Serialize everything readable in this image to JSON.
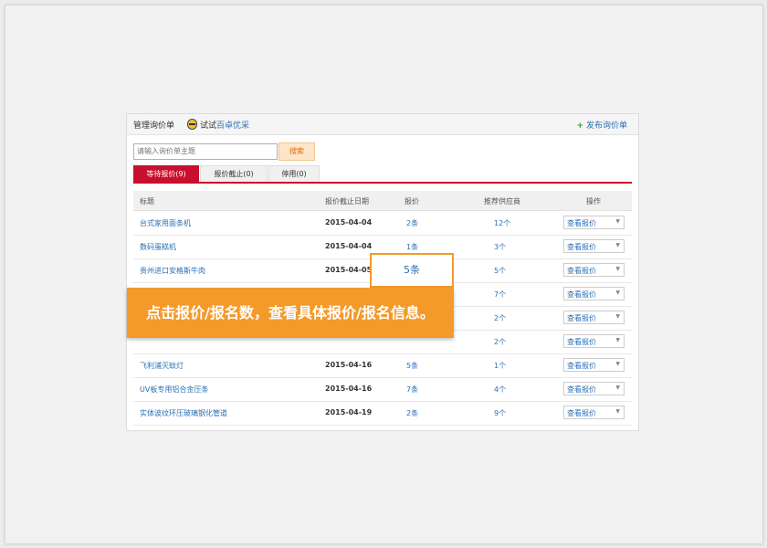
{
  "header": {
    "title": "管理询价单",
    "trial_prefix": "试试",
    "trial_brand": "百卓优采",
    "publish_label": "发布询价单"
  },
  "search": {
    "placeholder": "请输入询价单主题",
    "button_label": "搜索"
  },
  "tabs": [
    {
      "label": "等待报价(9)",
      "active": true
    },
    {
      "label": "报价截止(0)",
      "active": false
    },
    {
      "label": "停用(0)",
      "active": false
    }
  ],
  "table": {
    "headers": [
      "标题",
      "报价截止日期",
      "报价",
      "推荐供应商",
      "操作"
    ],
    "rows": [
      {
        "title": "台式家用面条机",
        "date": "2015-04-04",
        "quotes": "2条",
        "suppliers": "12个",
        "action": "查看报价"
      },
      {
        "title": "数码蛋糕机",
        "date": "2015-04-04",
        "quotes": "1条",
        "suppliers": "3个",
        "action": "查看报价"
      },
      {
        "title": "贵州进口安格斯牛肉",
        "date": "2015-04-05",
        "quotes": "",
        "suppliers": "5个",
        "action": "查看报价"
      },
      {
        "title": "",
        "date": "",
        "quotes": "",
        "suppliers": "7个",
        "action": "查看报价"
      },
      {
        "title": "",
        "date": "",
        "quotes": "",
        "suppliers": "2个",
        "action": "查看报价"
      },
      {
        "title": "",
        "date": "",
        "quotes": "",
        "suppliers": "2个",
        "action": "查看报价"
      },
      {
        "title": "飞利浦灭蚊灯",
        "date": "2015-04-16",
        "quotes": "5条",
        "suppliers": "1个",
        "action": "查看报价"
      },
      {
        "title": "UV板专用铝合金压条",
        "date": "2015-04-16",
        "quotes": "7条",
        "suppliers": "4个",
        "action": "查看报价"
      },
      {
        "title": "实体波纹环压玻璃钢化管道",
        "date": "2015-04-19",
        "quotes": "2条",
        "suppliers": "9个",
        "action": "查看报价"
      }
    ]
  },
  "callout": {
    "value": "5条",
    "banner_text": "点击报价/报名数，查看具体报价/报名信息。"
  },
  "colors": {
    "accent_red": "#c8102e",
    "link_blue": "#2a6fb5",
    "callout_orange": "#f39a2b"
  }
}
